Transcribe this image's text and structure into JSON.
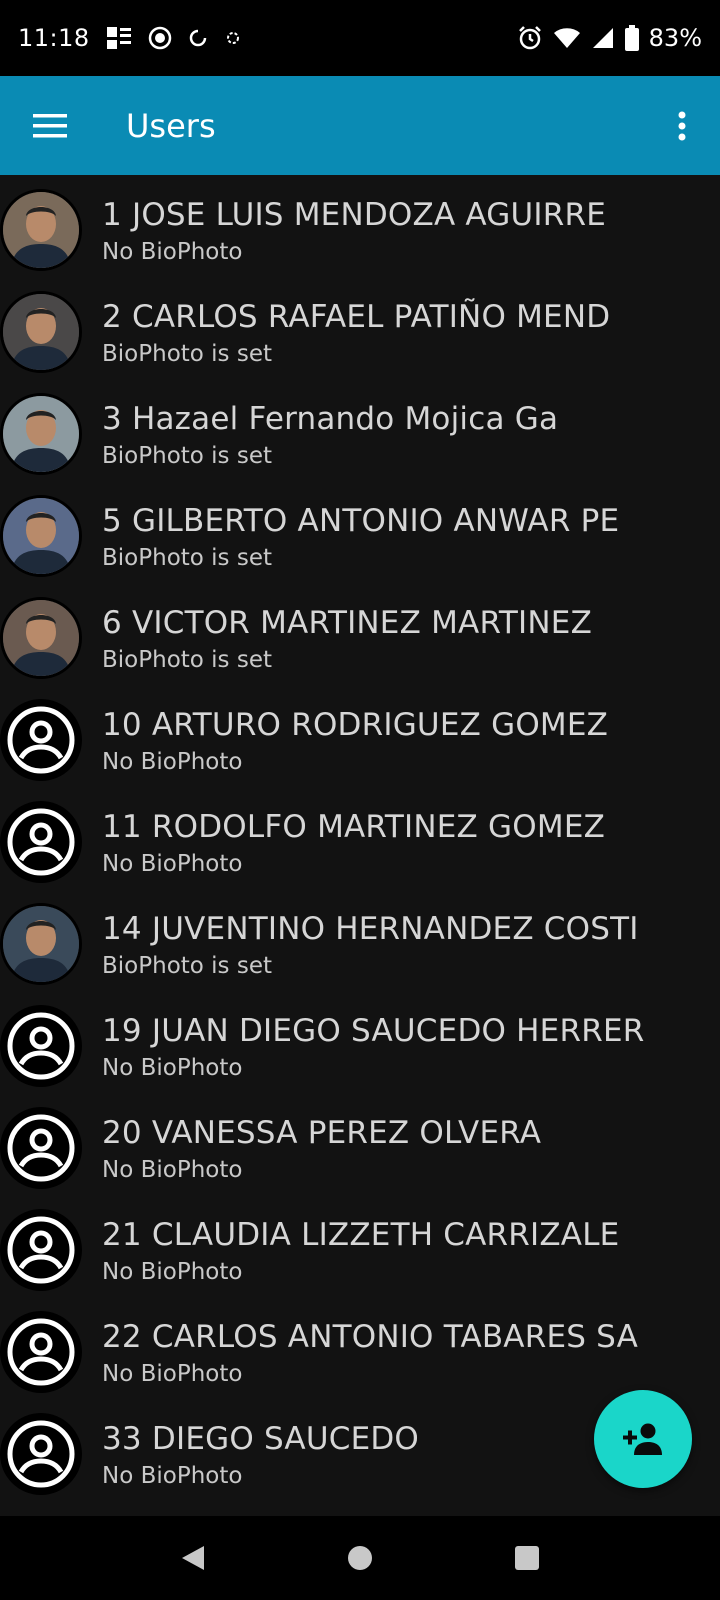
{
  "status_bar": {
    "time": "11:18",
    "battery": "83%"
  },
  "app_bar": {
    "title": "Users"
  },
  "users": [
    {
      "title": "1 JOSE LUIS MENDOZA AGUIRRE",
      "status": "No BioPhoto",
      "avatar": "photo",
      "tint": "#7a6a5a"
    },
    {
      "title": "2 CARLOS RAFAEL PATIÑO MEND",
      "status": "BioPhoto is set",
      "avatar": "photo",
      "tint": "#4a4848"
    },
    {
      "title": "3 Hazael Fernando Mojica Ga",
      "status": "BioPhoto is set",
      "avatar": "photo",
      "tint": "#8c9aa0"
    },
    {
      "title": "5 GILBERTO ANTONIO ANWAR PE",
      "status": "BioPhoto is set",
      "avatar": "photo",
      "tint": "#5a6a8a"
    },
    {
      "title": "6 VICTOR MARTINEZ MARTINEZ",
      "status": "BioPhoto is set",
      "avatar": "photo",
      "tint": "#6a5a50"
    },
    {
      "title": "10 ARTURO RODRIGUEZ GOMEZ",
      "status": "No BioPhoto",
      "avatar": "placeholder"
    },
    {
      "title": "11 RODOLFO MARTINEZ GOMEZ",
      "status": "No BioPhoto",
      "avatar": "placeholder"
    },
    {
      "title": "14 JUVENTINO HERNANDEZ COSTI",
      "status": "BioPhoto is set",
      "avatar": "photo",
      "tint": "#3a4a5a"
    },
    {
      "title": "19 JUAN DIEGO SAUCEDO HERRER",
      "status": "No BioPhoto",
      "avatar": "placeholder"
    },
    {
      "title": "20 VANESSA PEREZ OLVERA",
      "status": "No BioPhoto",
      "avatar": "placeholder"
    },
    {
      "title": "21 CLAUDIA LIZZETH CARRIZALE",
      "status": "No BioPhoto",
      "avatar": "placeholder"
    },
    {
      "title": "22 CARLOS ANTONIO TABARES SA",
      "status": "No BioPhoto",
      "avatar": "placeholder"
    },
    {
      "title": "33 DIEGO SAUCEDO",
      "status": "No BioPhoto",
      "avatar": "placeholder"
    }
  ],
  "fab": {
    "icon": "add-user-icon"
  },
  "colors": {
    "app_bar": "#0a8bb4",
    "fab": "#1ad6c9",
    "background": "#121212"
  }
}
